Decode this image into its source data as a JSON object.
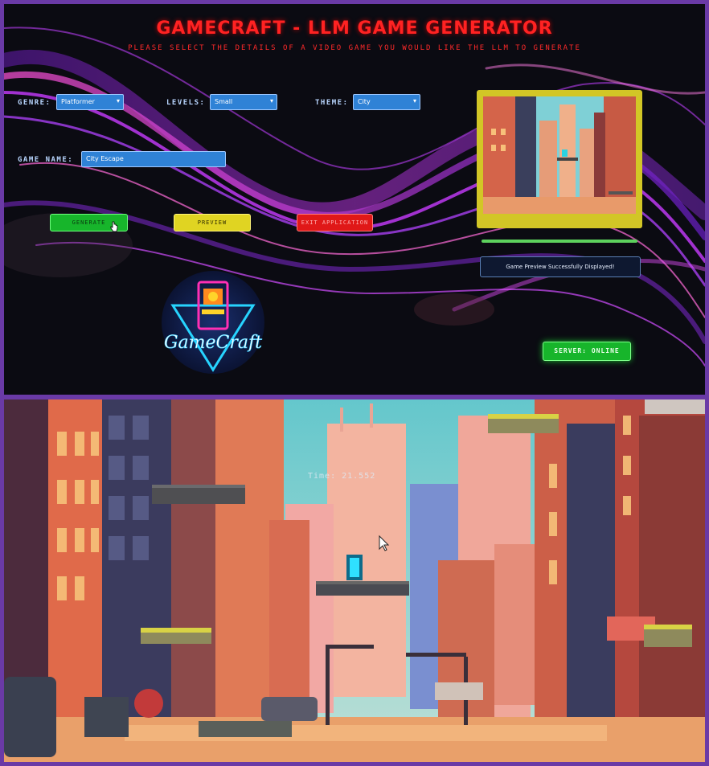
{
  "app": {
    "title": "GAMECRAFT - LLM GAME GENERATOR",
    "subtitle": "PLEASE SELECT THE DETAILS OF A VIDEO GAME YOU WOULD LIKE THE LLM TO GENERATE"
  },
  "form": {
    "genre_label": "GENRE:",
    "genre_value": "Platformer",
    "levels_label": "LEVELS:",
    "levels_value": "Small",
    "theme_label": "THEME:",
    "theme_value": "City",
    "name_label": "GAME NAME:",
    "name_value": "City Escape"
  },
  "buttons": {
    "generate": "GENERATE",
    "preview": "PREVIEW",
    "exit": "EXIT APPLICATION"
  },
  "preview": {
    "progress_fraction": 1.0,
    "status_text": "Game Preview Successfully Displayed!"
  },
  "server": {
    "status_text": "SERVER: ONLINE"
  },
  "logo": {
    "text": "GameCraft"
  },
  "game": {
    "timer_text": "Time: 21.552"
  },
  "icons": [
    "chevron-down-icon",
    "cursor-icon",
    "arcade-cabinet-icon"
  ]
}
